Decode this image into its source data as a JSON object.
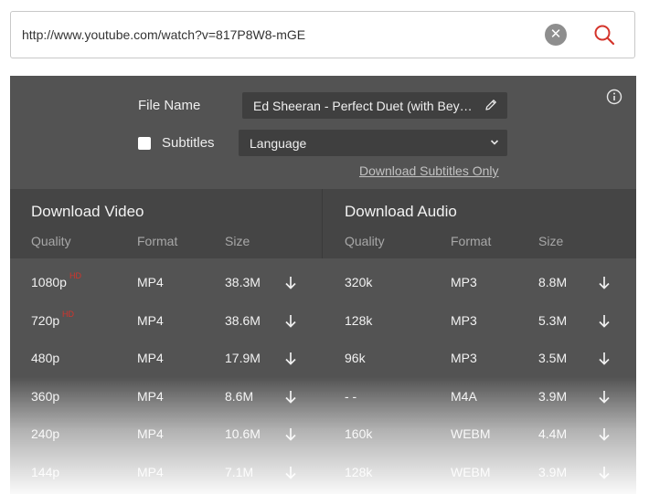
{
  "url_bar": {
    "value": "http://www.youtube.com/watch?v=817P8W8-mGE",
    "clear_icon": "close-icon",
    "search_icon": "search-icon"
  },
  "options": {
    "file_name_label": "File Name",
    "file_name_value": "Ed Sheeran - Perfect Duet (with Beyo...",
    "subtitles_label": "Subtitles",
    "subtitles_checked": false,
    "language_value": "Language",
    "download_subtitles_link": "Download Subtitles Only"
  },
  "video": {
    "title": "Download Video",
    "columns": [
      "Quality",
      "Format",
      "Size"
    ],
    "rows": [
      {
        "quality": "1080p",
        "badge": "HD",
        "format": "MP4",
        "size": "38.3M"
      },
      {
        "quality": "720p",
        "badge": "HD",
        "format": "MP4",
        "size": "38.6M"
      },
      {
        "quality": "480p",
        "badge": "",
        "format": "MP4",
        "size": "17.9M"
      },
      {
        "quality": "360p",
        "badge": "",
        "format": "MP4",
        "size": "8.6M"
      },
      {
        "quality": "240p",
        "badge": "",
        "format": "MP4",
        "size": "10.6M"
      },
      {
        "quality": "144p",
        "badge": "",
        "format": "MP4",
        "size": "7.1M"
      }
    ]
  },
  "audio": {
    "title": "Download Audio",
    "columns": [
      "Quality",
      "Format",
      "Size"
    ],
    "rows": [
      {
        "quality": "320k",
        "format": "MP3",
        "size": "8.8M"
      },
      {
        "quality": "128k",
        "format": "MP3",
        "size": "5.3M"
      },
      {
        "quality": "96k",
        "format": "MP3",
        "size": "3.5M"
      },
      {
        "quality": "- -",
        "format": "M4A",
        "size": "3.9M"
      },
      {
        "quality": "160k",
        "format": "WEBM",
        "size": "4.4M"
      },
      {
        "quality": "128k",
        "format": "WEBM",
        "size": "3.9M"
      }
    ]
  },
  "colors": {
    "panel": "#535353",
    "header": "#454545",
    "input": "#3f3f3f",
    "hd_badge": "#d4342b",
    "search_icon": "#d4342b"
  }
}
